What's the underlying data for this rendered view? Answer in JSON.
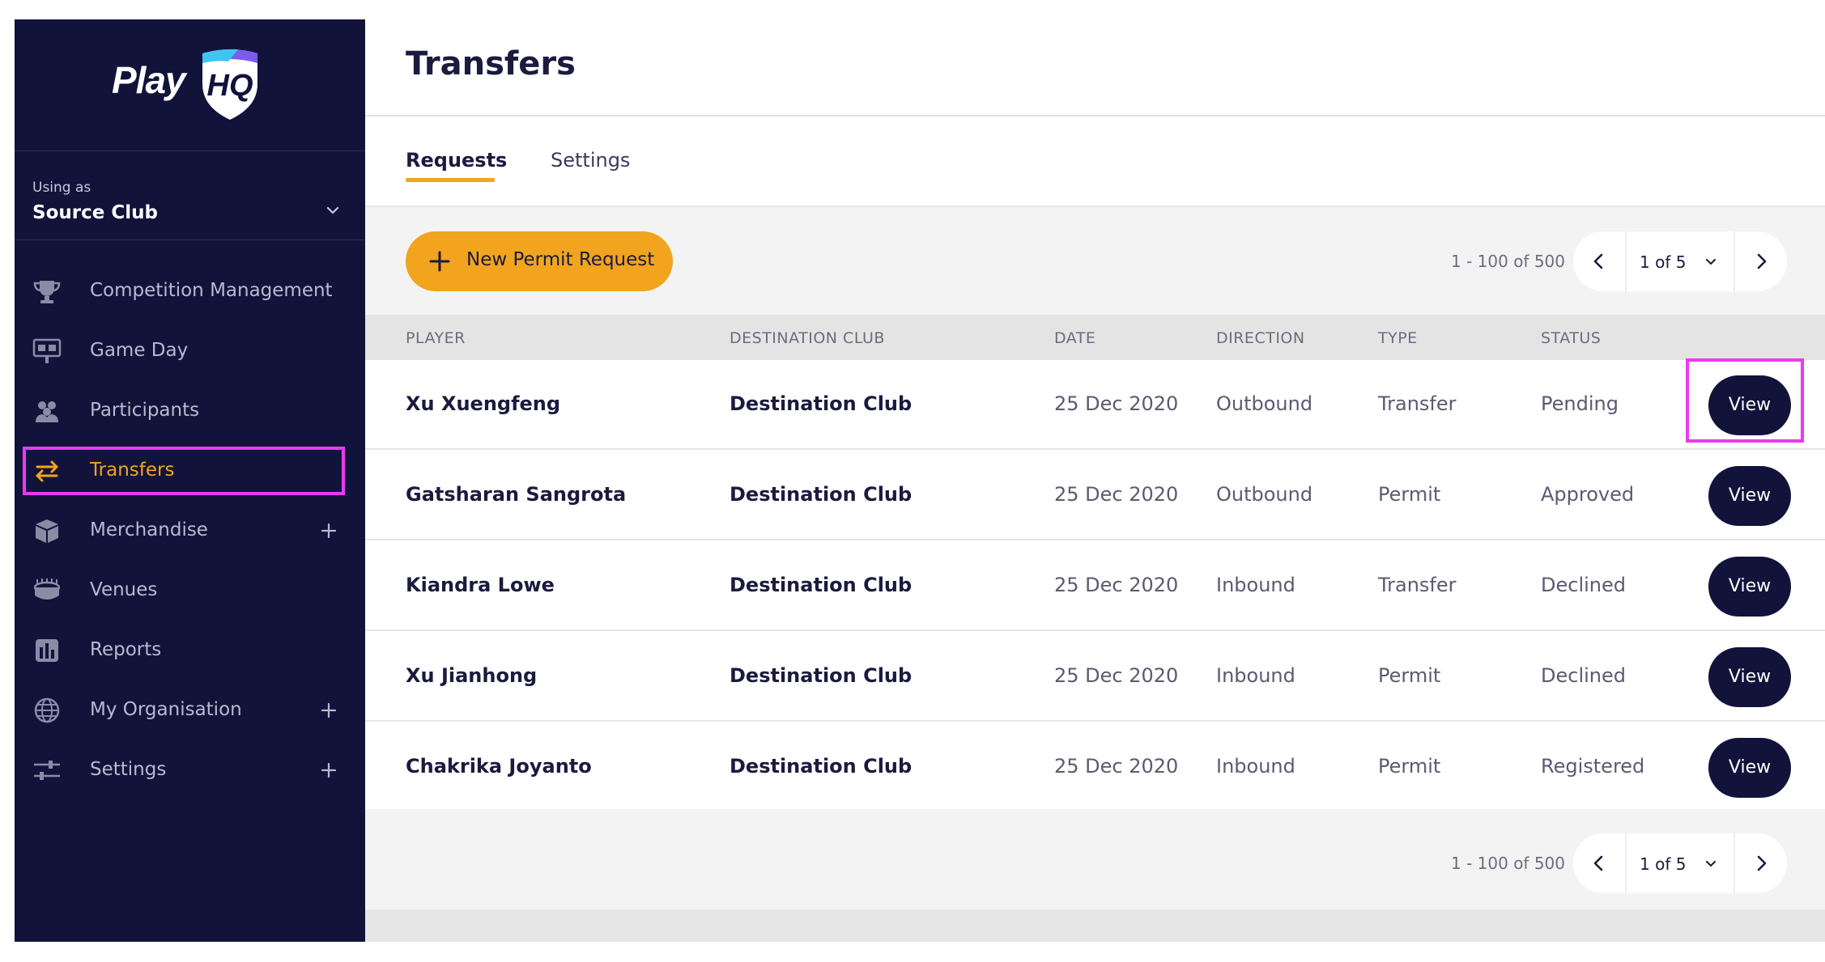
{
  "app": {
    "logo_text": "Play",
    "logo_badge": "HQ"
  },
  "sidebar": {
    "using_as_label": "Using as",
    "using_as_value": "Source Club",
    "items": [
      {
        "label": "Competition Management",
        "icon": "trophy-icon",
        "expandable": false
      },
      {
        "label": "Game Day",
        "icon": "scoreboard-icon",
        "expandable": false
      },
      {
        "label": "Participants",
        "icon": "people-icon",
        "expandable": false
      },
      {
        "label": "Transfers",
        "icon": "transfer-arrows-icon",
        "expandable": false,
        "active": true
      },
      {
        "label": "Merchandise",
        "icon": "box-icon",
        "expandable": true
      },
      {
        "label": "Venues",
        "icon": "stadium-icon",
        "expandable": false
      },
      {
        "label": "Reports",
        "icon": "reports-icon",
        "expandable": false
      },
      {
        "label": "My Organisation",
        "icon": "globe-icon",
        "expandable": true
      },
      {
        "label": "Settings",
        "icon": "sliders-icon",
        "expandable": true
      }
    ]
  },
  "page": {
    "title": "Transfers"
  },
  "tabs": [
    {
      "label": "Requests",
      "active": true
    },
    {
      "label": "Settings",
      "active": false
    }
  ],
  "toolbar": {
    "new_button_label": "New Permit Request"
  },
  "pagination": {
    "range": "1 - 100 of 500",
    "page": "1 of 5"
  },
  "table": {
    "columns": [
      "PLAYER",
      "DESTINATION CLUB",
      "DATE",
      "DIRECTION",
      "TYPE",
      "STATUS"
    ],
    "action_label": "View",
    "rows": [
      {
        "player": "Xu Xuengfeng",
        "club": "Destination Club",
        "date": "25 Dec 2020",
        "direction": "Outbound",
        "type": "Transfer",
        "status": "Pending"
      },
      {
        "player": "Gatsharan Sangrota",
        "club": "Destination Club",
        "date": "25 Dec 2020",
        "direction": "Outbound",
        "type": "Permit",
        "status": "Approved"
      },
      {
        "player": "Kiandra Lowe",
        "club": "Destination Club",
        "date": "25 Dec 2020",
        "direction": "Inbound",
        "type": "Transfer",
        "status": "Declined"
      },
      {
        "player": "Xu Jianhong",
        "club": "Destination Club",
        "date": "25 Dec 2020",
        "direction": "Inbound",
        "type": "Permit",
        "status": "Declined"
      },
      {
        "player": "Chakrika Joyanto",
        "club": "Destination Club",
        "date": "25 Dec 2020",
        "direction": "Inbound",
        "type": "Permit",
        "status": "Registered"
      }
    ]
  },
  "colors": {
    "sidebar_bg": "#12133a",
    "accent": "#f2a41f",
    "highlight": "#ee38f0",
    "button_dark": "#12133a"
  }
}
